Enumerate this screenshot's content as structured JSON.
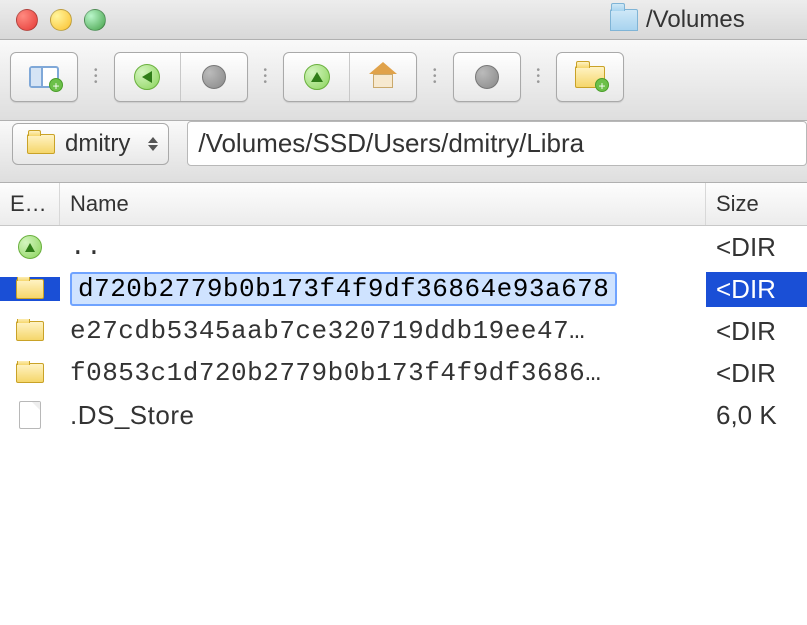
{
  "window": {
    "title": "/Volumes"
  },
  "location": {
    "dropdown_label": "dmitry",
    "path": "/Volumes/SSD/Users/dmitry/Libra"
  },
  "columns": {
    "ext": "E…",
    "name": "Name",
    "size": "Size"
  },
  "rows": [
    {
      "icon": "up",
      "name": "..",
      "size": "<DIR"
    },
    {
      "icon": "folder",
      "name": "d720b2779b0b173f4f9df36864e93a678",
      "size": "<DIR",
      "selected": true,
      "editing": true
    },
    {
      "icon": "folder",
      "name": "e27cdb5345aab7ce320719ddb19ee47…",
      "size": "<DIR"
    },
    {
      "icon": "folder",
      "name": "f0853c1d720b2779b0b173f4f9df3686…",
      "size": "<DIR"
    },
    {
      "icon": "file",
      "name": ".DS_Store",
      "size": "6,0 K"
    }
  ]
}
